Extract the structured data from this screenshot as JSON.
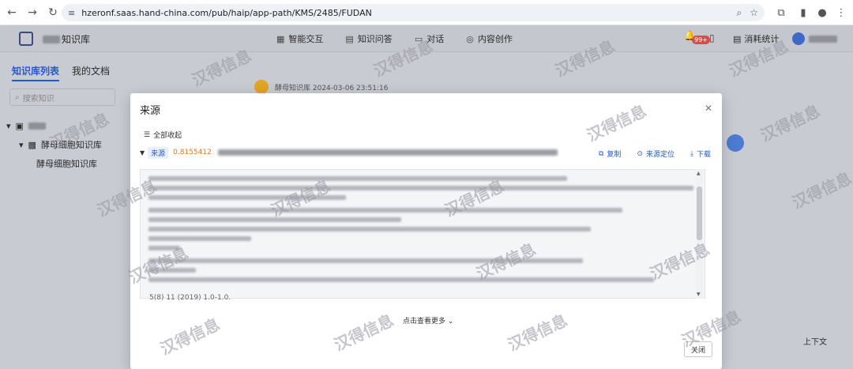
{
  "browser": {
    "url": "hzeronf.saas.hand-china.com/pub/haip/app-path/KMS/2485/FUDAN"
  },
  "app": {
    "kb_name": "知识库",
    "nav": [
      {
        "label": "智能交互",
        "icon": "chat-grid-icon"
      },
      {
        "label": "知识问答",
        "icon": "book-icon"
      },
      {
        "label": "对话",
        "icon": "message-icon"
      },
      {
        "label": "内容创作",
        "icon": "bulb-icon"
      }
    ],
    "badge": "99+",
    "stats_label": "消耗统计"
  },
  "sidebar": {
    "tabs": [
      "知识库列表",
      "我的文档"
    ],
    "search_placeholder": "搜索知识",
    "tree": {
      "child_label": "酵母细胞知识库",
      "leaf_label": "酵母细胞知识库"
    }
  },
  "chat": {
    "meta": "酵母知识库 2024-03-06 23:51:16"
  },
  "floating": {
    "updown_label": "上下文"
  },
  "modal": {
    "title": "来源",
    "collapse_all": "全部收起",
    "source_tag": "来源",
    "score": "0.8155412",
    "actions": {
      "copy": "复制",
      "locate": "来源定位",
      "download": "下载"
    },
    "content_tail": "5(8) 11 (2019) 1.0-1.0.",
    "more_label": "点击查看更多",
    "close_label": "关闭"
  },
  "watermark": "汉得信息"
}
